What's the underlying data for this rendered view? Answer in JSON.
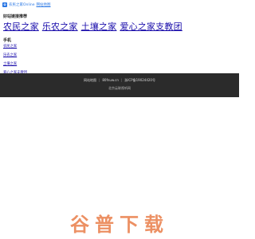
{
  "topbar": {
    "brand": "农民之家Online",
    "brand_link": "网站地图"
  },
  "main": {
    "section_title": "好站链接推荐",
    "big_links": [
      "农民之家",
      "乐农之家",
      "土壤之家",
      "爱心之家支教团"
    ],
    "sub_title": "手机",
    "small_links": [
      "农民之家",
      "乐农之家",
      "土壤之家",
      "爱心之家支教团"
    ]
  },
  "footer": {
    "items": [
      "网站地图",
      "80fnuw.cn",
      "浙ICP备19024420号"
    ],
    "line2": "北京云联视听网"
  },
  "watermark": {
    "text": "谷普下载"
  },
  "colors": {
    "accent": "#2b78e4",
    "link": "#1a0dab",
    "footer_bg": "#2b2b2b",
    "watermark": "#e66b2f"
  }
}
